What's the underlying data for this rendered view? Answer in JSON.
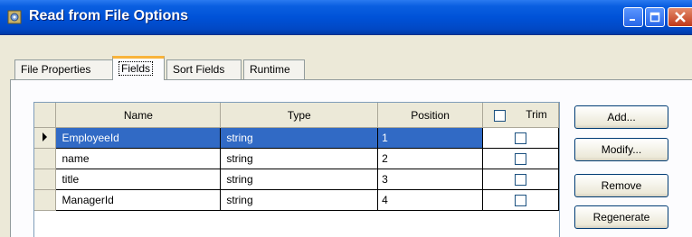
{
  "window": {
    "title": "Read from File Options"
  },
  "tabs": [
    {
      "label": "File Properties",
      "active": false
    },
    {
      "label": "Fields",
      "active": true
    },
    {
      "label": "Sort Fields",
      "active": false
    },
    {
      "label": "Runtime",
      "active": false
    }
  ],
  "grid": {
    "columns": [
      "Name",
      "Type",
      "Position",
      "Trim"
    ],
    "rows": [
      {
        "name": "EmployeeId",
        "type": "string",
        "position": "1",
        "trim": false,
        "selected": true
      },
      {
        "name": "name",
        "type": "string",
        "position": "2",
        "trim": false,
        "selected": false
      },
      {
        "name": "title",
        "type": "string",
        "position": "3",
        "trim": false,
        "selected": false
      },
      {
        "name": "ManagerId",
        "type": "string",
        "position": "4",
        "trim": false,
        "selected": false
      }
    ]
  },
  "buttons": {
    "add": "Add...",
    "modify": "Modify...",
    "remove": "Remove",
    "regenerate": "Regenerate"
  },
  "colors": {
    "titlebar": "#0052d8",
    "selection": "#316ac5",
    "dialog": "#ece9d8",
    "active_tab_accent": "#f8b33a"
  },
  "icons": {
    "app": "gear-app-icon",
    "minimize": "minimize-icon",
    "maximize": "maximize-icon",
    "close": "close-icon",
    "row_indicator": "current-row-arrow-icon"
  }
}
